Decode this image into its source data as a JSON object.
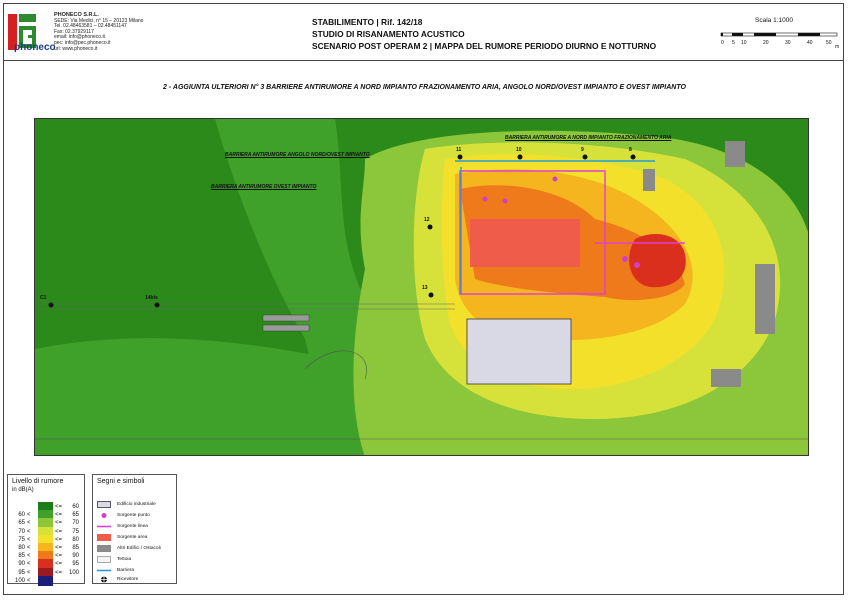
{
  "company": {
    "logo_text": "phoneco",
    "name": "PHONECO S.R.L.",
    "address": "SEDE: Via Medici, n° 15 – 20123 Milano",
    "tel": "Tel. 02.48463581 – 02.48451147",
    "fax": "Fax: 02.37929117",
    "email": "email: info@phoneco.it",
    "pec": "pec: info@pec.phoneco.it",
    "url": "url: www.phoneco.it"
  },
  "header": {
    "line1": "STABILIMENTO | Rif. 142/18",
    "line2": "STUDIO DI RISANAMENTO ACUSTICO",
    "line3": "SCENARIO POST OPERAM 2 | MAPPA DEL RUMORE PERIODO DIURNO E NOTTURNO"
  },
  "scale": {
    "label": "Scala 1:1000",
    "ticks": [
      "0",
      "5",
      "10",
      "20",
      "30",
      "40",
      "50"
    ],
    "unit": "m"
  },
  "subtitle": "2 - AGGIUNTA ULTERIORI N° 3 BARRIERE ANTIRUMORE A NORD IMPIANTO FRAZIONAMENTO ARIA, ANGOLO NORD/OVEST IMPIANTO E OVEST IMPIANTO",
  "map": {
    "barrier_labels": {
      "north": "BARRIERA ANTIRUMORE A NORD IMPIANTO FRAZIONAMENTO ARIA",
      "northwest": "BARRIERA ANTIRUMORE ANGOLO NORD/OVEST IMPIANTO",
      "west": "BARRIERA ANTIRUMORE OVEST IMPIANTO"
    },
    "receivers": {
      "r11": "11",
      "r10": "10",
      "r9": "9",
      "r8": "8",
      "r12": "12",
      "r13": "13",
      "c1": "C1",
      "r14": "14bis"
    }
  },
  "legend_noise": {
    "title": "Livello di rumore",
    "unit": "in dB(A)",
    "rows": [
      {
        "lo": "",
        "lt": "",
        "le": "<=",
        "hi": "60",
        "color": "#1a7d1a"
      },
      {
        "lo": "60",
        "lt": "<",
        "le": "<=",
        "hi": "65",
        "color": "#3fa02a"
      },
      {
        "lo": "65",
        "lt": "<",
        "le": "<=",
        "hi": "70",
        "color": "#8cc63a"
      },
      {
        "lo": "70",
        "lt": "<",
        "le": "<=",
        "hi": "75",
        "color": "#d6e23a"
      },
      {
        "lo": "75",
        "lt": "<",
        "le": "<=",
        "hi": "80",
        "color": "#f2e02a"
      },
      {
        "lo": "80",
        "lt": "<",
        "le": "<=",
        "hi": "85",
        "color": "#f5b51e"
      },
      {
        "lo": "85",
        "lt": "<",
        "le": "<=",
        "hi": "90",
        "color": "#ee7a1c"
      },
      {
        "lo": "90",
        "lt": "<",
        "le": "<=",
        "hi": "95",
        "color": "#d92f1c"
      },
      {
        "lo": "95",
        "lt": "<",
        "le": "<=",
        "hi": "100",
        "color": "#9a1a20"
      },
      {
        "lo": "100",
        "lt": "<",
        "le": "",
        "hi": "",
        "color": "#1c1e7a"
      }
    ]
  },
  "legend_symbols": {
    "title": "Segni e simboli",
    "items": {
      "building": "Edificio industriale",
      "point_source": "Sorgente punto",
      "line_source": "Sorgente linea",
      "area_source": "Sorgente area",
      "obstacles": "Altri Edifici / Ostacoli",
      "canopy": "Tettoia",
      "barrier": "Barriera",
      "receiver": "Ricevitore"
    }
  }
}
